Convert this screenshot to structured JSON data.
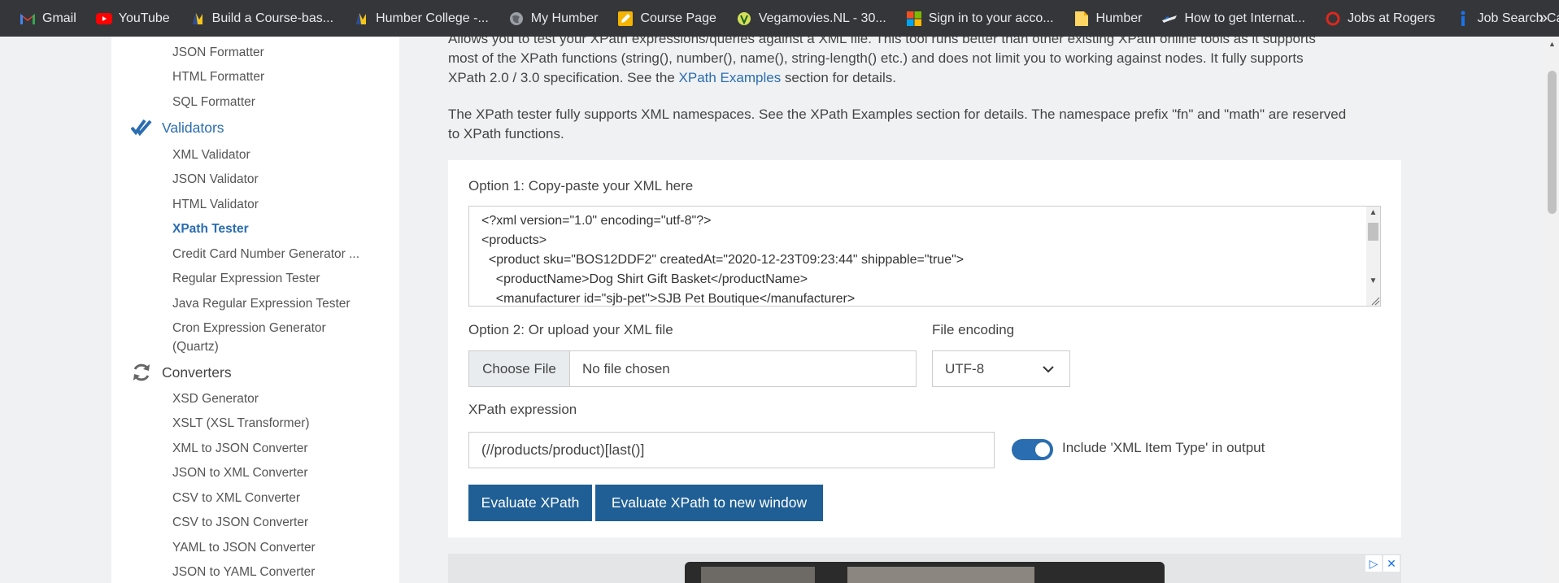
{
  "bookmarks": [
    {
      "label": "Gmail",
      "icon": "gmail-icon"
    },
    {
      "label": "YouTube",
      "icon": "youtube-icon"
    },
    {
      "label": "Build a Course-bas...",
      "icon": "humber-icon"
    },
    {
      "label": "Humber College -...",
      "icon": "humber-icon"
    },
    {
      "label": "My Humber",
      "icon": "globe-icon"
    },
    {
      "label": "Course Page",
      "icon": "pencil-icon"
    },
    {
      "label": "Vegamovies.NL - 30...",
      "icon": "vegamovies-icon"
    },
    {
      "label": "Sign in to your acco...",
      "icon": "microsoft-icon"
    },
    {
      "label": "Humber",
      "icon": "note-icon"
    },
    {
      "label": "How to get Internat...",
      "icon": "plane-icon"
    },
    {
      "label": "Jobs at Rogers",
      "icon": "rogers-icon"
    },
    {
      "label": "Job Search Canada...",
      "icon": "info-icon"
    }
  ],
  "bookmarks_more": "»",
  "sidebar": {
    "formatters": [
      "JSON Formatter",
      "HTML Formatter",
      "SQL Formatter"
    ],
    "validators_label": "Validators",
    "validators": [
      "XML Validator",
      "JSON Validator",
      "HTML Validator",
      "XPath Tester",
      "Credit Card Number Generator ...",
      "Regular Expression Tester",
      "Java Regular Expression Tester",
      "Cron Expression Generator",
      "(Quartz)"
    ],
    "active_item": "XPath Tester",
    "converters_label": "Converters",
    "converters": [
      "XSD Generator",
      "XSLT (XSL Transformer)",
      "XML to JSON Converter",
      "JSON to XML Converter",
      "CSV to XML Converter",
      "CSV to JSON Converter",
      "YAML to JSON Converter",
      "JSON to YAML Converter"
    ]
  },
  "intro": {
    "line1": "Allows you to test your XPath expressions/queries against a XML file. This tool runs better than other existing XPath online tools as it supports",
    "line2": "most of the XPath functions (string(), number(), name(), string-length() etc.) and does not limit you to working against nodes. It fully supports",
    "line3_pre": "XPath 2.0 / 3.0 specification. See the ",
    "line3_link": "XPath Examples",
    "line3_post": " section for details.",
    "ns_line1": "The XPath tester fully supports XML namespaces. See the XPath Examples section for details. The namespace prefix \"fn\" and \"math\" are reserved",
    "ns_line2": "to XPath functions."
  },
  "form": {
    "option1_label": "Option 1: Copy-paste your XML here",
    "xml_lines": [
      "<?xml version=\"1.0\" encoding=\"utf-8\"?>",
      "<products>",
      "  <product sku=\"BOS12DDF2\" createdAt=\"2020-12-23T09:23:44\" shippable=\"true\">",
      "    <productName>Dog Shirt Gift Basket</productName>",
      "    <manufacturer id=\"sjb-pet\">SJB Pet Boutique</manufacturer>"
    ],
    "option2_label": "Option 2: Or upload your XML file",
    "choose_file": "Choose File",
    "no_file": "No file chosen",
    "encoding_label": "File encoding",
    "encoding_value": "UTF-8",
    "xpath_label": "XPath expression",
    "xpath_value": "(//products/product)[last()]",
    "include_type_label": "Include 'XML Item Type' in output",
    "include_type_on": true,
    "evaluate": "Evaluate XPath",
    "evaluate_new": "Evaluate XPath to new window"
  },
  "colors": {
    "accent": "#2a6db0",
    "button": "#1f5f95",
    "bookmark_bar": "#35363a"
  }
}
